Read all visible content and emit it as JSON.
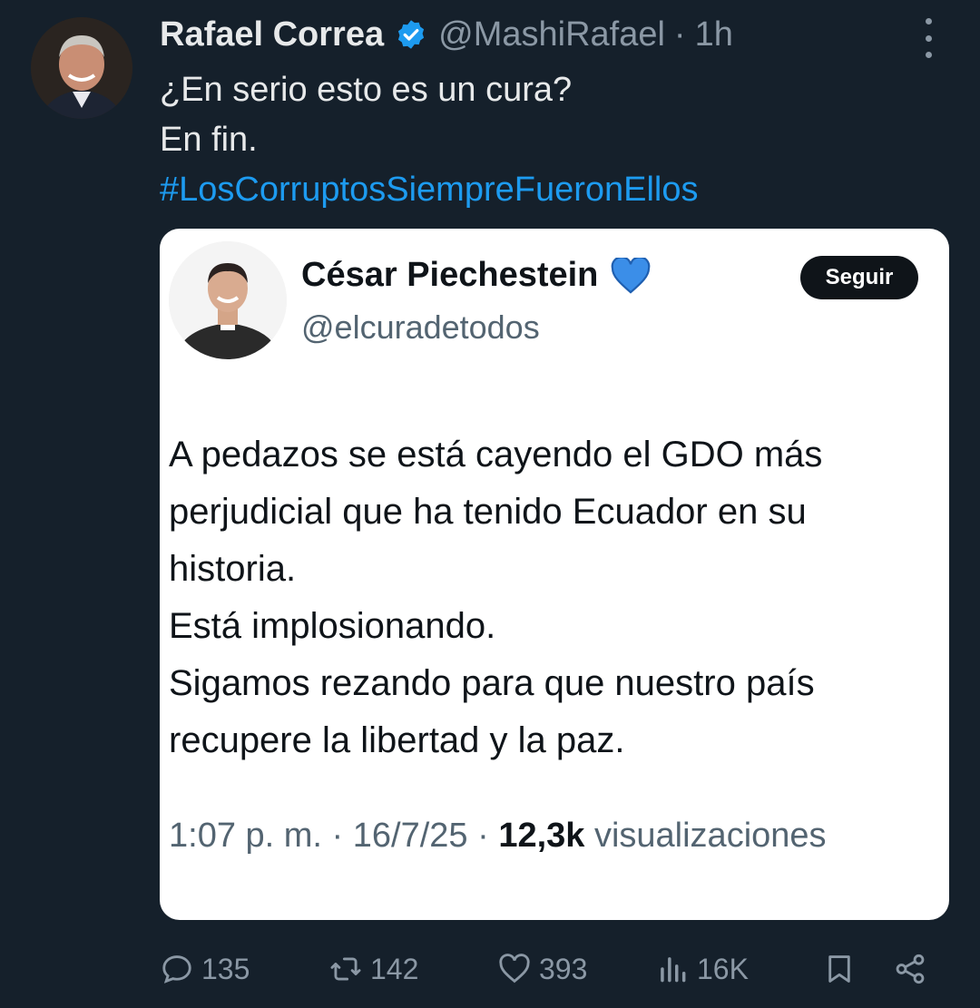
{
  "tweet": {
    "author_name": "Rafael Correa",
    "author_handle": "@MashiRafael",
    "separator": "·",
    "time": "1h",
    "text_line1": "¿En serio esto es un cura?",
    "text_line2": "En fin.",
    "hashtag": "#LosCorruptosSiempreFueronEllos"
  },
  "quoted": {
    "author_name": "César Piechestein",
    "author_handle": "@elcuradetodos",
    "follow_label": "Seguir",
    "body_lines": [
      "A pedazos se está cayendo el GDO más",
      "perjudicial que ha tenido Ecuador en su",
      "historia.",
      "Está implosionando.",
      "Sigamos rezando para que nuestro país",
      "recupere la libertad y la paz."
    ],
    "meta_time": "1:07 p. m. · 16/7/25 · ",
    "meta_views_count": "12,3k",
    "meta_views_label": " visualizaciones"
  },
  "actions": {
    "replies": "135",
    "retweets": "142",
    "likes": "393",
    "views": "16K"
  },
  "icons": {
    "verified": "verified-badge-icon",
    "heart": "blue-heart-icon",
    "reply": "reply-icon",
    "retweet": "retweet-icon",
    "like": "like-icon",
    "views": "views-icon",
    "bookmark": "bookmark-icon",
    "share": "share-icon",
    "more": "more-icon"
  },
  "colors": {
    "background": "#15202b",
    "accent": "#1d9bf0",
    "muted": "#8b98a5",
    "card": "#ffffff"
  }
}
